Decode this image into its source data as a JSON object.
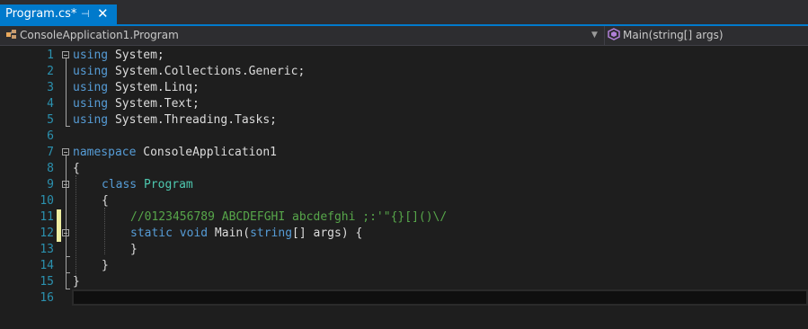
{
  "tab": {
    "title": "Program.cs*",
    "pin_glyph": "⊣",
    "close_glyph": "✕"
  },
  "navbar": {
    "left_label": "ConsoleApplication1.Program",
    "left_icon": "class-icon",
    "right_label": "Main(string[] args)",
    "right_icon": "method-icon",
    "dropdown_glyph": "▼"
  },
  "colors": {
    "background": "#1e1e1e",
    "accent": "#007acc",
    "keyword": "#569cd6",
    "type": "#4ec9b0",
    "comment": "#57a64a",
    "line_number": "#2b91af",
    "change_bar": "#efefa1"
  },
  "code": {
    "line_numbers": [
      "1",
      "2",
      "3",
      "4",
      "5",
      "6",
      "7",
      "8",
      "9",
      "10",
      "11",
      "12",
      "13",
      "14",
      "15",
      "16"
    ],
    "l1": {
      "kw": "using",
      "rest": " System;"
    },
    "l2": {
      "kw": "using",
      "rest": " System.Collections.Generic;"
    },
    "l3": {
      "kw": "using",
      "rest": " System.Linq;"
    },
    "l4": {
      "kw": "using",
      "rest": " System.Text;"
    },
    "l5": {
      "kw": "using",
      "rest": " System.Threading.Tasks;"
    },
    "l7": {
      "kw": "namespace",
      "rest": " ConsoleApplication1"
    },
    "l8": {
      "text": "{"
    },
    "l9": {
      "kw": "class",
      "type": "Program"
    },
    "l10": {
      "text": "{"
    },
    "l11": {
      "comment": "//0123456789 ABCDEFGHI abcdefghi ;:'\"{}[]()\\/"
    },
    "l12": {
      "kw1": "static",
      "kw2": "void",
      "name": " Main(",
      "kw3": "string",
      "rest": "[] args) {"
    },
    "l13": {
      "text": "}"
    },
    "l14": {
      "text": "}"
    },
    "l15": {
      "text": "}"
    }
  }
}
